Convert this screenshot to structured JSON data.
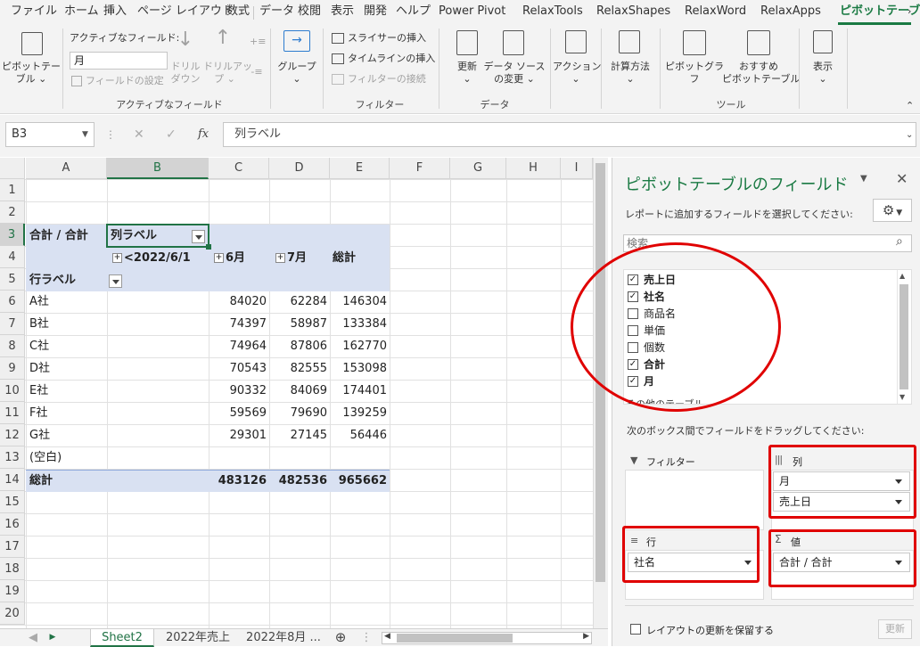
{
  "ribbon_tabs": [
    "ファイル",
    "ホーム",
    "挿入",
    "ページ レイアウト",
    "数式",
    "データ",
    "校閲",
    "表示",
    "開発",
    "ヘルプ",
    "Power Pivot",
    "RelaxTools",
    "RelaxShapes",
    "RelaxWord",
    "RelaxApps",
    "ピボットテーブ"
  ],
  "ribbon": {
    "pivot_table": "ピボットテー\nブル ⌄",
    "active_field_label": "アクティブなフィールド:",
    "active_field_value": "月",
    "field_settings": "フィールドの設定",
    "drilldown": "ドリル\nダウン",
    "drillup": "ドリルアッ\nプ ⌄",
    "group_active": "アクティブなフィールド",
    "group_btn": "グループ\n⌄",
    "slicer": "スライサーの挿入",
    "timeline": "タイムラインの挿入",
    "filter_conn": "フィルターの接続",
    "group_filter": "フィルター",
    "refresh": "更新\n⌄",
    "change_source": "データ ソース\nの変更 ⌄",
    "group_data": "データ",
    "action": "アクション\n⌄",
    "calc": "計算方法\n⌄",
    "pivot_chart": "ピボットグラフ",
    "recommended": "おすすめ\nピボットテーブル",
    "group_tools": "ツール",
    "show": "表示\n⌄"
  },
  "formula_bar": {
    "name_box": "B3",
    "formula": "列ラベル",
    "cancel": "✕",
    "enter": "✓",
    "fx": "fx"
  },
  "columns": [
    "A",
    "B",
    "C",
    "D",
    "E",
    "F",
    "G",
    "H",
    "I"
  ],
  "rows": [
    "1",
    "2",
    "3",
    "4",
    "5",
    "6",
    "7",
    "8",
    "9",
    "10",
    "11",
    "12",
    "13",
    "14",
    "15",
    "16",
    "17",
    "18",
    "19",
    "20"
  ],
  "pivot": {
    "corner": "合計 / 合計",
    "col_label": "列ラベル",
    "col_headers": [
      "<2022/6/1",
      "6月",
      "7月",
      "総計"
    ],
    "row_label": "行ラベル",
    "body": [
      {
        "name": "A社",
        "c": "84020",
        "d": "62284",
        "e": "146304"
      },
      {
        "name": "B社",
        "c": "74397",
        "d": "58987",
        "e": "133384"
      },
      {
        "name": "C社",
        "c": "74964",
        "d": "87806",
        "e": "162770"
      },
      {
        "name": "D社",
        "c": "70543",
        "d": "82555",
        "e": "153098"
      },
      {
        "name": "E社",
        "c": "90332",
        "d": "84069",
        "e": "174401"
      },
      {
        "name": "F社",
        "c": "59569",
        "d": "79690",
        "e": "139259"
      },
      {
        "name": "G社",
        "c": "29301",
        "d": "27145",
        "e": "56446"
      },
      {
        "name": "(空白)",
        "c": "",
        "d": "",
        "e": ""
      }
    ],
    "total_label": "総計",
    "total": {
      "c": "483126",
      "d": "482536",
      "e": "965662"
    }
  },
  "pane": {
    "title": "ピボットテーブルのフィールド",
    "subtitle": "レポートに追加するフィールドを選択してください:",
    "search_placeholder": "検索",
    "fields": [
      {
        "name": "売上日",
        "checked": true
      },
      {
        "name": "社名",
        "checked": true
      },
      {
        "name": "商品名",
        "checked": false
      },
      {
        "name": "単価",
        "checked": false
      },
      {
        "name": "個数",
        "checked": false
      },
      {
        "name": "合計",
        "checked": true
      },
      {
        "name": "月",
        "checked": true
      }
    ],
    "other_tables": "その他のテーブル...",
    "drag_hint": "次のボックス間でフィールドをドラッグしてください:",
    "filter_label": "フィルター",
    "columns_label": "列",
    "rows_label": "行",
    "values_label": "値",
    "columns_items": [
      "月",
      "売上日"
    ],
    "rows_items": [
      "社名"
    ],
    "values_items": [
      "合計 / 合計"
    ],
    "defer_label": "レイアウトの更新を保留する",
    "update_btn": "更新"
  },
  "sheet_tabs": [
    "Sheet2",
    "2022年売上",
    "2022年8月 ..."
  ],
  "colors": {
    "accent": "#1a7a43",
    "pivot_header": "#d9e1f2",
    "highlight": "#e00000"
  }
}
